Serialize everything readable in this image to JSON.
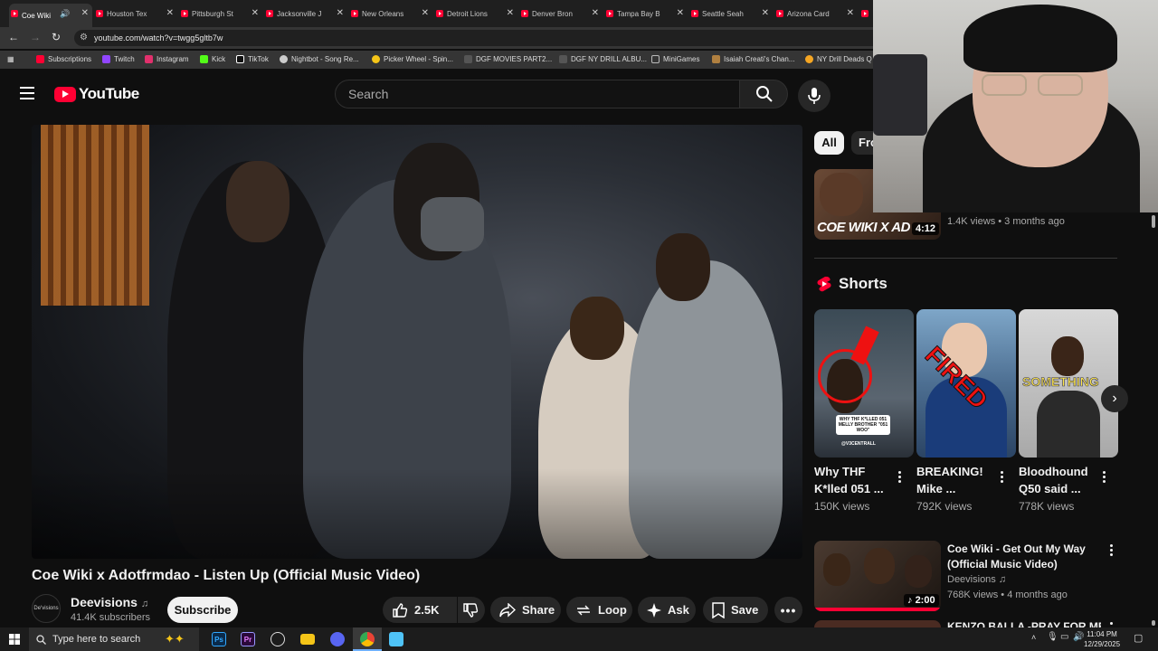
{
  "browser": {
    "tabs": [
      {
        "title": "Coe Wiki",
        "active": true
      },
      {
        "title": "Houston Tex"
      },
      {
        "title": "Pittsburgh St"
      },
      {
        "title": "Jacksonville J"
      },
      {
        "title": "New Orleans"
      },
      {
        "title": "Detroit Lions"
      },
      {
        "title": "Denver Bron"
      },
      {
        "title": "Tampa Bay B"
      },
      {
        "title": "Seattle Seah"
      },
      {
        "title": "Arizona Card"
      }
    ],
    "url": "youtube.com/watch?v=twgg5gltb7w",
    "bookmarks": [
      {
        "label": "Subscriptions",
        "color": "#ff0033"
      },
      {
        "label": "Twitch",
        "color": "#9146ff"
      },
      {
        "label": "Instagram",
        "color": "#e1306c"
      },
      {
        "label": "Kick",
        "color": "#53fc18"
      },
      {
        "label": "TikTok",
        "color": "#ffffff"
      },
      {
        "label": "Nightbot - Song Re...",
        "color": "#cccccc"
      },
      {
        "label": "Picker Wheel - Spin...",
        "color": "#f5c518"
      },
      {
        "label": "DGF MOVIES PART2...",
        "color": "#666666"
      },
      {
        "label": "DGF NY DRILL ALBU...",
        "color": "#666666"
      },
      {
        "label": "MiniGames",
        "color": "#9a9a9a"
      },
      {
        "label": "Isaiah Creati's Chan...",
        "color": "#b08040"
      },
      {
        "label": "NY Drill Deads Q",
        "color": "#f5a623"
      }
    ]
  },
  "youtube": {
    "logo_text": "YouTube",
    "search_placeholder": "Search",
    "video": {
      "title": "Coe Wiki x Adotfrmdao - Listen Up (Official Music Video)",
      "channel": "Deevisions",
      "channel_avatar_text": "De'visions",
      "subscribers": "41.4K subscribers",
      "subscribe_label": "Subscribe",
      "likes": "2.5K",
      "share_label": "Share",
      "loop_label": "Loop",
      "ask_label": "Ask",
      "save_label": "Save"
    },
    "chips": [
      "All",
      "Fro"
    ],
    "top_related": {
      "thumb_text": "COE WIKI X AD",
      "duration": "4:12",
      "meta": "1.4K views • 3 months ago"
    },
    "shorts": {
      "heading": "Shorts",
      "items": [
        {
          "title": "Why THF K*lled 051 ...",
          "views": "150K views",
          "overlay": "WHY THF K*LLED 051 MELLY BROTHER \"051 WOO\"",
          "tag": "@V3CENTRALL"
        },
        {
          "title": "BREAKING! Mike ...",
          "views": "792K views",
          "overlay": "FIRED"
        },
        {
          "title": "Bloodhound Q50 said ...",
          "views": "778K views",
          "overlay": "SOMETHING"
        }
      ]
    },
    "related": [
      {
        "title": "Coe Wiki - Get Out My Way (Official Music Video)",
        "channel": "Deevisions",
        "meta": "768K views • 4 months ago",
        "duration": "2:00"
      },
      {
        "title": "KENZO BALLA -PRAY FOR ME"
      }
    ]
  },
  "taskbar": {
    "search_placeholder": "Type here to search",
    "time": "11:04 PM",
    "date": "12/29/2025"
  }
}
